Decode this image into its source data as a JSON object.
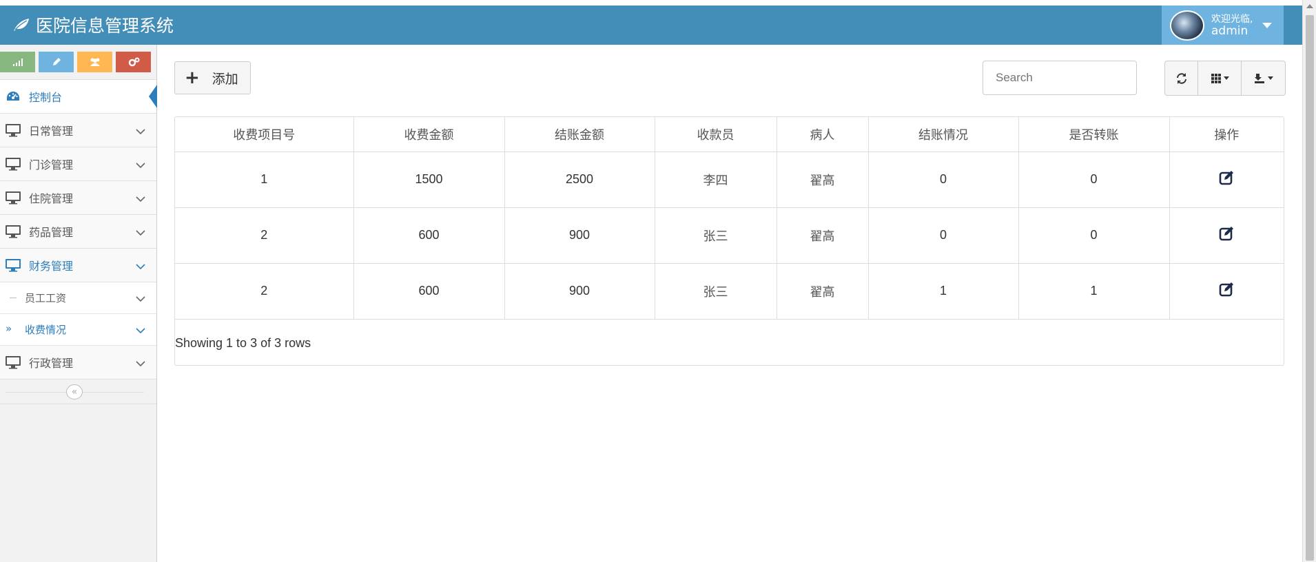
{
  "header": {
    "title": "医院信息管理系统",
    "logo_icon": "leaf-icon",
    "welcome": "欢迎光临,",
    "username": "admin",
    "bg_color": "#438eb9"
  },
  "sidebar": {
    "shortcuts": [
      {
        "icon": "signal-icon",
        "color": "#87b87f"
      },
      {
        "icon": "pencil-icon",
        "color": "#6fb3e0"
      },
      {
        "icon": "users-icon",
        "color": "#ffb752"
      },
      {
        "icon": "cogs-icon",
        "color": "#d15b47"
      }
    ],
    "dashboard": "控制台",
    "items": [
      {
        "label": "日常管理"
      },
      {
        "label": "门诊管理"
      },
      {
        "label": "住院管理"
      },
      {
        "label": "药品管理"
      },
      {
        "label": "财务管理"
      }
    ],
    "subitems": [
      {
        "label": "员工工资"
      },
      {
        "label": "收费情况"
      }
    ],
    "last_item": {
      "label": "行政管理"
    }
  },
  "toolbar": {
    "add_label": "添加",
    "search_placeholder": "Search"
  },
  "table": {
    "headers": [
      "收费项目号",
      "收费金额",
      "结账金额",
      "收款员",
      "病人",
      "结账情况",
      "是否转账",
      "操作"
    ],
    "rows": [
      [
        "1",
        "1500",
        "2500",
        "李四",
        "翟高",
        "0",
        "0"
      ],
      [
        "2",
        "600",
        "900",
        "张三",
        "翟高",
        "0",
        "0"
      ],
      [
        "2",
        "600",
        "900",
        "张三",
        "翟高",
        "1",
        "1"
      ]
    ],
    "footer": "Showing 1 to 3 of 3 rows"
  }
}
